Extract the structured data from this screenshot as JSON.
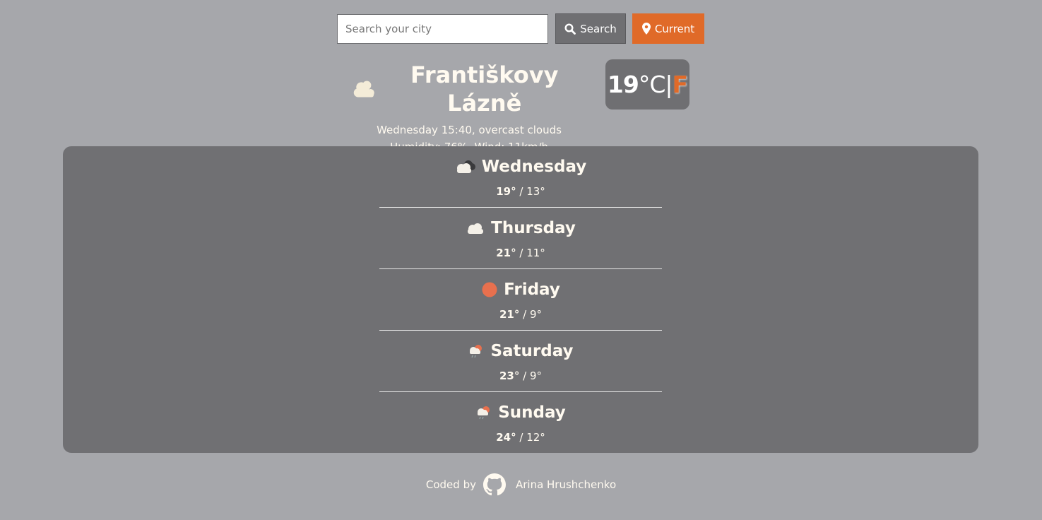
{
  "search": {
    "placeholder": "Search your city",
    "search_label": "Search",
    "current_label": "Current",
    "search_icon": "magnifier-icon",
    "current_icon": "map-pin-icon"
  },
  "current": {
    "city": "Františkovy Lázně",
    "icon": "clouds-icon",
    "datetime_desc": "Wednesday 15:40, overcast clouds",
    "details": "Humidity: 76%, Wind: 11km/h",
    "temp": "19",
    "unit_c": "°C",
    "divider": "|",
    "unit_f": "F"
  },
  "forecast": [
    {
      "day": "Wednesday",
      "hi": "19°",
      "lo": "13°",
      "icon": "broken-clouds-icon"
    },
    {
      "day": "Thursday",
      "hi": "21°",
      "lo": "11°",
      "icon": "cloud-icon"
    },
    {
      "day": "Friday",
      "hi": "21°",
      "lo": "9°",
      "icon": "sun-icon"
    },
    {
      "day": "Saturday",
      "hi": "23°",
      "lo": "9°",
      "icon": "rain-sun-icon"
    },
    {
      "day": "Sunday",
      "hi": "24°",
      "lo": "12°",
      "icon": "rain-sun-icon"
    }
  ],
  "footer": {
    "coded_by": "Coded by",
    "author": "Arina Hrushchenko",
    "icon": "github-icon"
  },
  "colors": {
    "background": "#a6a7ab",
    "panel": "#707073",
    "accent": "#e06a28",
    "text": "#fffaf0"
  }
}
